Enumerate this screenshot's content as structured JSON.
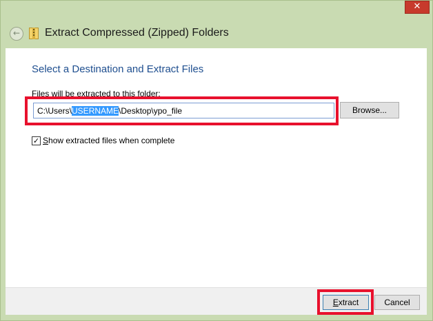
{
  "window": {
    "title": "Extract Compressed (Zipped) Folders",
    "close_glyph": "✕"
  },
  "icons": {
    "back": "back-arrow-icon",
    "zip": "zip-folder-icon",
    "close": "close-icon"
  },
  "content": {
    "heading": "Select a Destination and Extract Files",
    "field_label": "Files will be extracted to this folder:",
    "path_before": "C:\\Users\\",
    "path_selected": "USERNAME",
    "path_after": "\\Desktop\\ypo_file",
    "browse_label": "Browse...",
    "show_checkbox_checked": true,
    "show_label_mnemonic": "S",
    "show_label_rest": "how extracted files when complete"
  },
  "footer": {
    "extract_mnemonic": "E",
    "extract_rest": "xtract",
    "cancel_label": "Cancel"
  },
  "colors": {
    "heading": "#1e4e8f",
    "highlight": "#e8112d",
    "selection": "#3399ff",
    "frame": "#c9dbb2",
    "close": "#c73a2c"
  }
}
